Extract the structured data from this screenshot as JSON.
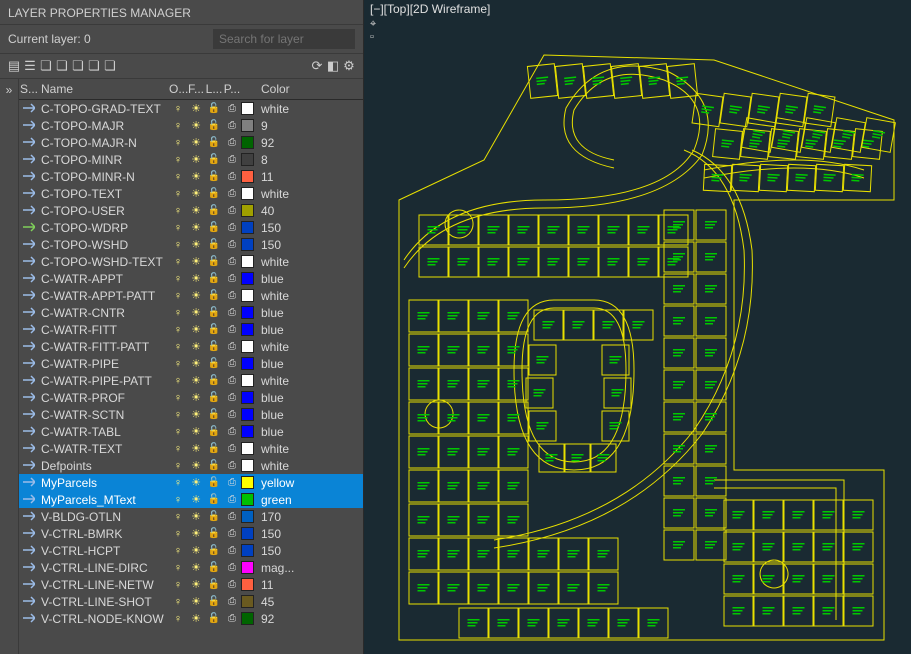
{
  "panel_title": "LAYER PROPERTIES MANAGER",
  "current_layer_label": "Current layer: 0",
  "search_placeholder": "Search for layer",
  "collapse_glyph": "»",
  "viewport_label": "[−][Top][2D Wireframe]",
  "header": {
    "status": "S...",
    "name": "Name",
    "on": "O...",
    "freeze": "F...",
    "lock": "L...",
    "plot": "P...",
    "color": "Color"
  },
  "toolbar_icons": [
    {
      "name": "new-layer-icon",
      "glyph": "▤"
    },
    {
      "name": "new-state-icon",
      "glyph": "☰"
    },
    {
      "name": "layer-states-1-icon",
      "glyph": "❏"
    },
    {
      "name": "layer-states-2-icon",
      "glyph": "❏"
    },
    {
      "name": "layer-states-3-icon",
      "glyph": "❏"
    },
    {
      "name": "layer-states-4-icon",
      "glyph": "❏"
    },
    {
      "name": "layer-states-5-icon",
      "glyph": "❏"
    }
  ],
  "toolbar_icons_right": [
    {
      "name": "refresh-icon",
      "glyph": "⟳"
    },
    {
      "name": "settings-toggle-icon",
      "glyph": "◧"
    },
    {
      "name": "settings-gear-icon",
      "glyph": "⚙"
    }
  ],
  "layers": [
    {
      "name": "C-TOPO-GRAD-TEXT",
      "color_hex": "#ffffff",
      "color_label": "white"
    },
    {
      "name": "C-TOPO-MAJR",
      "color_hex": "#808080",
      "color_label": "9"
    },
    {
      "name": "C-TOPO-MAJR-N",
      "color_hex": "#006400",
      "color_label": "92"
    },
    {
      "name": "C-TOPO-MINR",
      "color_hex": "#404040",
      "color_label": "8"
    },
    {
      "name": "C-TOPO-MINR-N",
      "color_hex": "#ff6040",
      "color_label": "11"
    },
    {
      "name": "C-TOPO-TEXT",
      "color_hex": "#ffffff",
      "color_label": "white"
    },
    {
      "name": "C-TOPO-USER",
      "color_hex": "#a0a000",
      "color_label": "40"
    },
    {
      "name": "C-TOPO-WDRP",
      "color_hex": "#0040c0",
      "color_label": "150",
      "status": "current"
    },
    {
      "name": "C-TOPO-WSHD",
      "color_hex": "#0040c0",
      "color_label": "150"
    },
    {
      "name": "C-TOPO-WSHD-TEXT",
      "color_hex": "#ffffff",
      "color_label": "white"
    },
    {
      "name": "C-WATR-APPT",
      "color_hex": "#0000ff",
      "color_label": "blue"
    },
    {
      "name": "C-WATR-APPT-PATT",
      "color_hex": "#ffffff",
      "color_label": "white"
    },
    {
      "name": "C-WATR-CNTR",
      "color_hex": "#0000ff",
      "color_label": "blue"
    },
    {
      "name": "C-WATR-FITT",
      "color_hex": "#0000ff",
      "color_label": "blue"
    },
    {
      "name": "C-WATR-FITT-PATT",
      "color_hex": "#ffffff",
      "color_label": "white"
    },
    {
      "name": "C-WATR-PIPE",
      "color_hex": "#0000ff",
      "color_label": "blue"
    },
    {
      "name": "C-WATR-PIPE-PATT",
      "color_hex": "#ffffff",
      "color_label": "white"
    },
    {
      "name": "C-WATR-PROF",
      "color_hex": "#0000ff",
      "color_label": "blue"
    },
    {
      "name": "C-WATR-SCTN",
      "color_hex": "#0000ff",
      "color_label": "blue"
    },
    {
      "name": "C-WATR-TABL",
      "color_hex": "#0000ff",
      "color_label": "blue"
    },
    {
      "name": "C-WATR-TEXT",
      "color_hex": "#ffffff",
      "color_label": "white"
    },
    {
      "name": "Defpoints",
      "color_hex": "#ffffff",
      "color_label": "white"
    },
    {
      "name": "MyParcels",
      "color_hex": "#ffff00",
      "color_label": "yellow",
      "selected": true
    },
    {
      "name": "MyParcels_MText",
      "color_hex": "#00c000",
      "color_label": "green",
      "selected": true
    },
    {
      "name": "V-BLDG-OTLN",
      "color_hex": "#0060c0",
      "color_label": "170"
    },
    {
      "name": "V-CTRL-BMRK",
      "color_hex": "#0040c0",
      "color_label": "150"
    },
    {
      "name": "V-CTRL-HCPT",
      "color_hex": "#0040c0",
      "color_label": "150"
    },
    {
      "name": "V-CTRL-LINE-DIRC",
      "color_hex": "#ff00ff",
      "color_label": "mag..."
    },
    {
      "name": "V-CTRL-LINE-NETW",
      "color_hex": "#ff6040",
      "color_label": "11"
    },
    {
      "name": "V-CTRL-LINE-SHOT",
      "color_hex": "#6a5a20",
      "color_label": "45"
    },
    {
      "name": "V-CTRL-NODE-KNOW",
      "color_hex": "#006400",
      "color_label": "92"
    }
  ],
  "chart_data": {
    "type": "map",
    "description": "Subdivision parcel map drawn in yellow outlines with small green multi-line text labels centered in each parcel. Roads form curving loops with cul-de-sacs.",
    "parcel_outline_color": "#e8e000",
    "parcel_label_color": "#00c800",
    "approx_parcel_count": 150
  }
}
